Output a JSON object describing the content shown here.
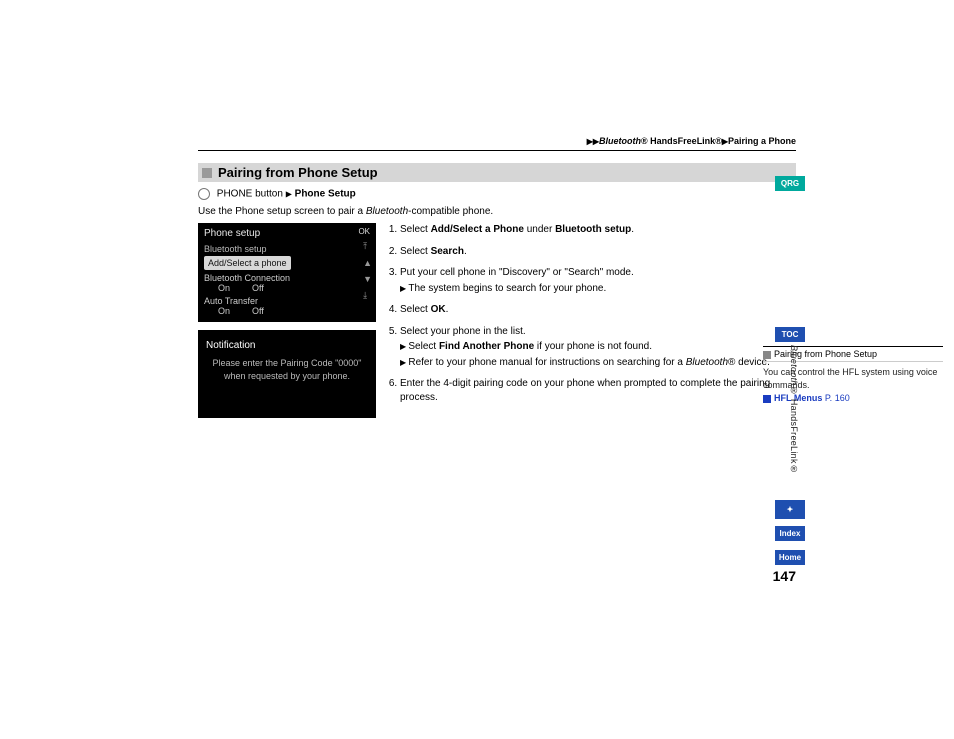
{
  "breadcrumb": {
    "part1": "Bluetooth",
    "reg": "®",
    "part2": " HandsFreeLink®",
    "part3": "Pairing a Phone"
  },
  "section": {
    "title": "Pairing from Phone Setup"
  },
  "command": {
    "phone_button": "PHONE button",
    "setup_label": "Phone Setup"
  },
  "intro": {
    "pre": "Use the Phone setup screen to pair a ",
    "bt": "Bluetooth",
    "post": "-compatible phone."
  },
  "screenshot1": {
    "title": "Phone setup",
    "ok": "OK",
    "item_bt_setup": "Bluetooth setup",
    "item_add": "Add/Select a phone",
    "item_conn": "Bluetooth Connection",
    "on": "On",
    "off": "Off",
    "item_auto": "Auto Transfer"
  },
  "screenshot2": {
    "title": "Notification",
    "line1": "Please enter the Pairing Code \"0000\"",
    "line2": "when requested by your phone."
  },
  "steps": {
    "s1a": "Select ",
    "s1b": "Add/Select a Phone",
    "s1c": " under ",
    "s1d": "Bluetooth setup",
    "s1e": ".",
    "s2a": "Select ",
    "s2b": "Search",
    "s2c": ".",
    "s3": "Put your cell phone in \"Discovery\" or \"Search\" mode.",
    "s3sub": "The system begins to search for your phone.",
    "s4a": "Select ",
    "s4b": "OK",
    "s4c": ".",
    "s5": "Select your phone in the list.",
    "s5sub1a": "Select ",
    "s5sub1b": "Find Another Phone",
    "s5sub1c": " if your phone is not found.",
    "s5sub2a": "Refer to your phone manual for instructions on searching for a ",
    "s5sub2b": "Bluetooth",
    "s5sub2c": "® device.",
    "s6": "Enter the 4-digit pairing code on your phone when prompted to complete the pairing process."
  },
  "sidenote": {
    "title": "Pairing from Phone Setup",
    "body": "You can control the HFL system using voice commands.",
    "link_label": "HFL Menus",
    "link_page": " P. 160"
  },
  "page_number": "147",
  "rail": {
    "qrg": "QRG",
    "toc": "TOC",
    "voice": "✦",
    "index": "Index",
    "home": "Home",
    "vlabel_bt": "Bluetooth",
    "vlabel_rest": "® HandsFreeLink®"
  }
}
